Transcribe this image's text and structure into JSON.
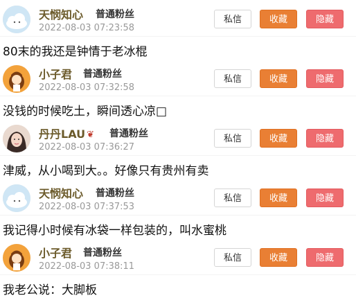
{
  "buttons": {
    "message": "私信",
    "favorite": "收藏",
    "hide": "隐藏"
  },
  "posts": [
    {
      "user": "天悯知心",
      "level": "普通粉丝",
      "time": "2022-08-03 07:23:58",
      "avatar": "cloud-avatar",
      "content": "80末的我还是钟情于老冰棍"
    },
    {
      "user": "小子君",
      "level": "普通粉丝",
      "time": "2022-08-03 07:32:58",
      "avatar": "cartoon-girl-avatar",
      "content": "没钱的时候吃土，瞬间透心凉□"
    },
    {
      "user": "丹丹LAU",
      "user_badge": "heart-icon",
      "level": "普通粉丝",
      "time": "2022-08-03 07:36:27",
      "avatar": "photo-avatar",
      "content": "津威，从小喝到大。。好像只有贵州有卖"
    },
    {
      "user": "天悯知心",
      "level": "普通粉丝",
      "time": "2022-08-03 07:37:53",
      "avatar": "cloud-avatar",
      "content": "我记得小时候有冰袋一样包装的，叫水蜜桃"
    },
    {
      "user": "小子君",
      "level": "普通粉丝",
      "time": "2022-08-03 07:38:11",
      "avatar": "cartoon-girl-avatar",
      "content": "我老公说：大脚板"
    }
  ],
  "colors": {
    "username": "#6b5a2a",
    "favorite_button": "#e97f34",
    "hide_button": "#ee6b6e",
    "timestamp": "#999999"
  }
}
